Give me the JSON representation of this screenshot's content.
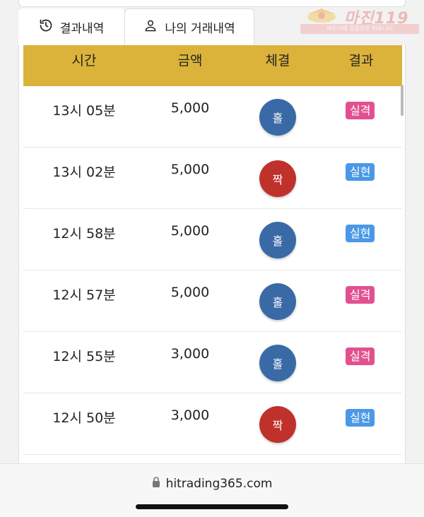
{
  "tabs": [
    {
      "label": "결과내역",
      "icon": "history-icon"
    },
    {
      "label": "나의 거래내역",
      "icon": "user-icon"
    }
  ],
  "watermark": {
    "title": "마진119",
    "subtitle": "마진거래 검증전문 커뮤니티"
  },
  "table": {
    "headers": [
      "시간",
      "금액",
      "체결",
      "결과"
    ],
    "rows": [
      {
        "time": "13시 05분",
        "amount": "5,000",
        "pick": "홀",
        "result": "실격"
      },
      {
        "time": "13시 02분",
        "amount": "5,000",
        "pick": "짝",
        "result": "실현"
      },
      {
        "time": "12시 58분",
        "amount": "5,000",
        "pick": "홀",
        "result": "실현"
      },
      {
        "time": "12시 57분",
        "amount": "5,000",
        "pick": "홀",
        "result": "실격"
      },
      {
        "time": "12시 55분",
        "amount": "3,000",
        "pick": "홀",
        "result": "실격"
      },
      {
        "time": "12시 50분",
        "amount": "3,000",
        "pick": "짝",
        "result": "실현"
      }
    ]
  },
  "browser": {
    "url": "hitrading365.com"
  },
  "colors": {
    "header": "#dcb33a",
    "odd": "#3a6aa6",
    "even": "#c0312c",
    "lose": "#e2508f",
    "win": "#4a98e6"
  }
}
